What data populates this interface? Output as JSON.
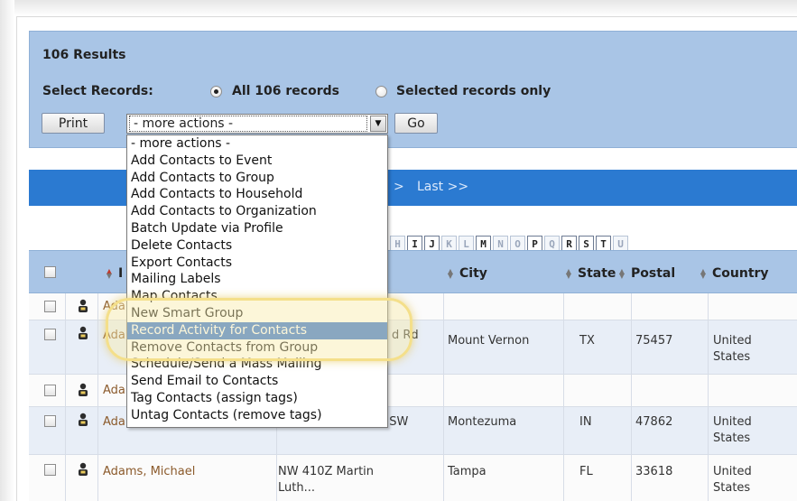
{
  "results": {
    "count_label": "106 Results",
    "select_label": "Select Records:",
    "option_all": "All 106 records",
    "option_selected": "Selected records only",
    "print_label": "Print",
    "go_label": "Go",
    "actions_value": "- more actions -"
  },
  "actions_menu": {
    "items": [
      "- more actions -",
      "Add Contacts to Event",
      "Add Contacts to Group",
      "Add Contacts to Household",
      "Add Contacts to Organization",
      "Batch Update via Profile",
      "Delete Contacts",
      "Export Contacts",
      "Mailing Labels",
      "Map Contacts",
      "New Smart Group",
      "Record Activity for Contacts",
      "Remove Contacts from Group",
      "Schedule/Send a Mass Mailing",
      "Send Email to Contacts",
      "Tag Contacts (assign tags)",
      "Untag Contacts (remove tags)"
    ],
    "selected_index": 11
  },
  "pager": {
    "gt": ">",
    "last_label": "Last >>"
  },
  "alpha_filter": {
    "letters": [
      "H",
      "I",
      "J",
      "K",
      "L",
      "M",
      "N",
      "O",
      "P",
      "Q",
      "R",
      "S",
      "T",
      "U"
    ],
    "active": [
      "I",
      "J",
      "M",
      "P",
      "R",
      "S",
      "T"
    ]
  },
  "table": {
    "columns": {
      "name_partial": "I",
      "city": "City",
      "state": "State",
      "postal": "Postal",
      "country": "Country"
    },
    "rows": [
      {
        "name": "Ada",
        "address": "",
        "city": "",
        "state": "",
        "postal": "",
        "country": ""
      },
      {
        "name": "Ada",
        "address": "d Rd",
        "city": "Mount Vernon",
        "state": "TX",
        "postal": "75457",
        "country_line1": "United",
        "country_line2": "States"
      },
      {
        "name": "Ada",
        "address": "",
        "city": "",
        "state": "",
        "postal": "",
        "country": ""
      },
      {
        "name": "Adams, Helmut",
        "address": "W 109Q Main Ave SW",
        "city": "Montezuma",
        "state": "IN",
        "postal": "47862",
        "country_line1": "United",
        "country_line2": "States"
      },
      {
        "name": "Adams, Michael",
        "address_line1": "NW 410Z Martin",
        "address_line2": "Luth...",
        "city": "Tampa",
        "state": "FL",
        "postal": "33618",
        "country_line1": "United",
        "country_line2": "States"
      }
    ]
  },
  "colors": {
    "panel_blue": "#a9c5e6",
    "pager_blue": "#2b7ad1",
    "selection_blue": "#2f6fd1",
    "link_brown": "#8b5a2b",
    "highlight_yellow": "#f4df8a"
  }
}
